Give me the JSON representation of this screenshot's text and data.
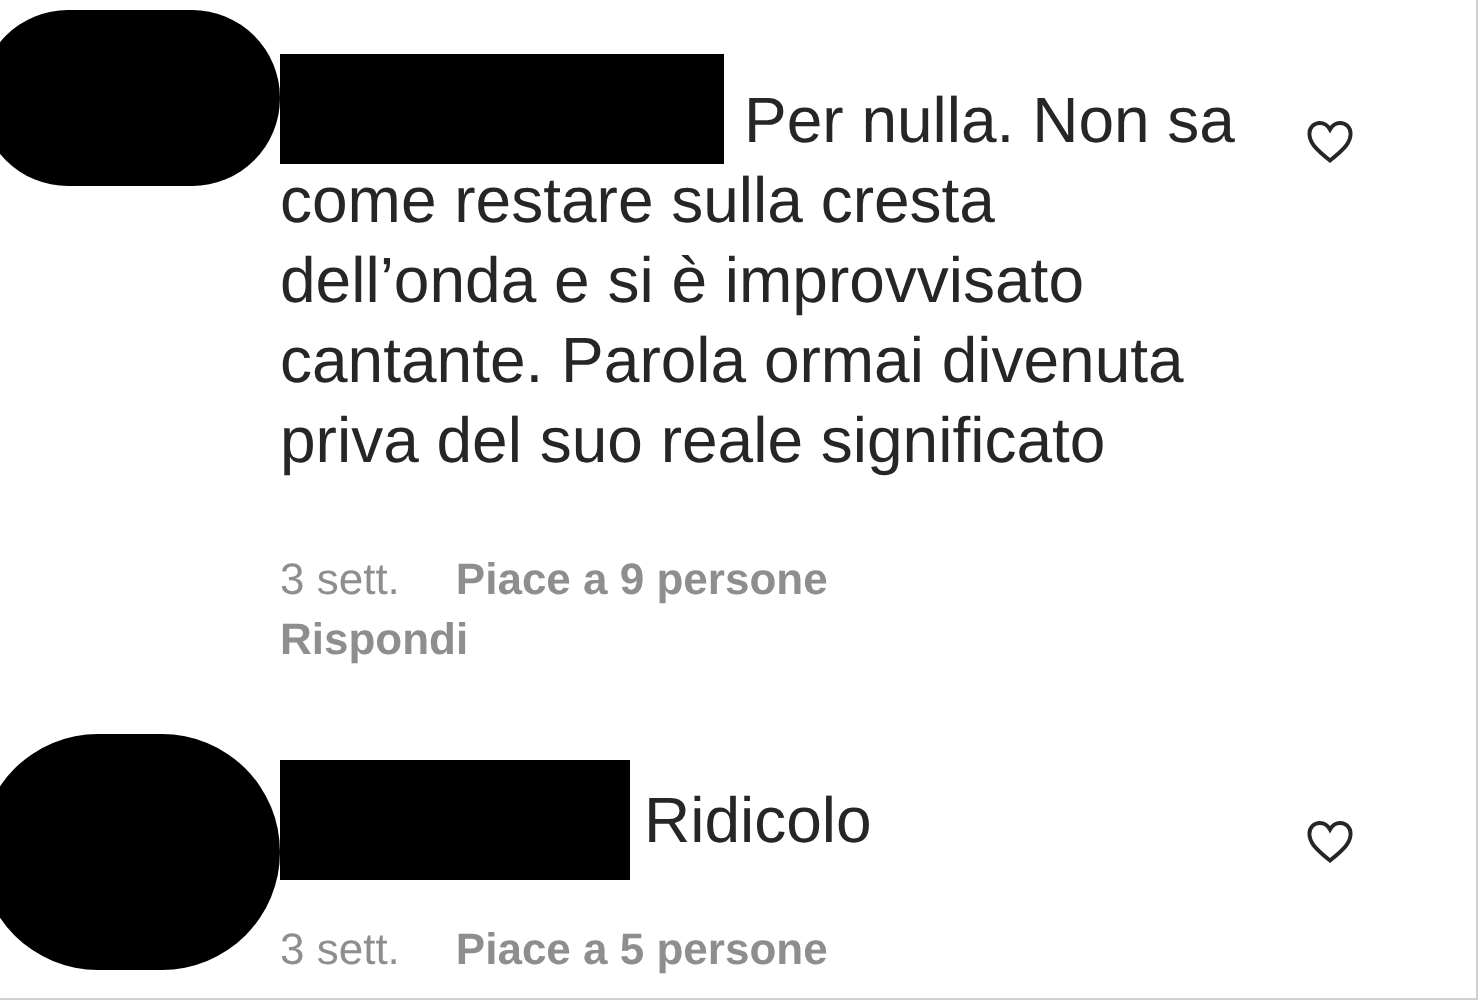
{
  "comments": [
    {
      "text_lines": [
        "Per nulla. Non sa",
        "come restare sulla cresta",
        "dell’onda e si è improvvisato",
        "cantante. Parola ormai divenuta",
        "priva del suo reale significato"
      ],
      "time": "3 sett.",
      "likes": "Piace a 9 persone",
      "reply": "Rispondi",
      "liked": false
    },
    {
      "text_lines": [
        "Ridicolo"
      ],
      "time": "3 sett.",
      "likes": "Piace a 5 persone",
      "liked": false
    }
  ]
}
